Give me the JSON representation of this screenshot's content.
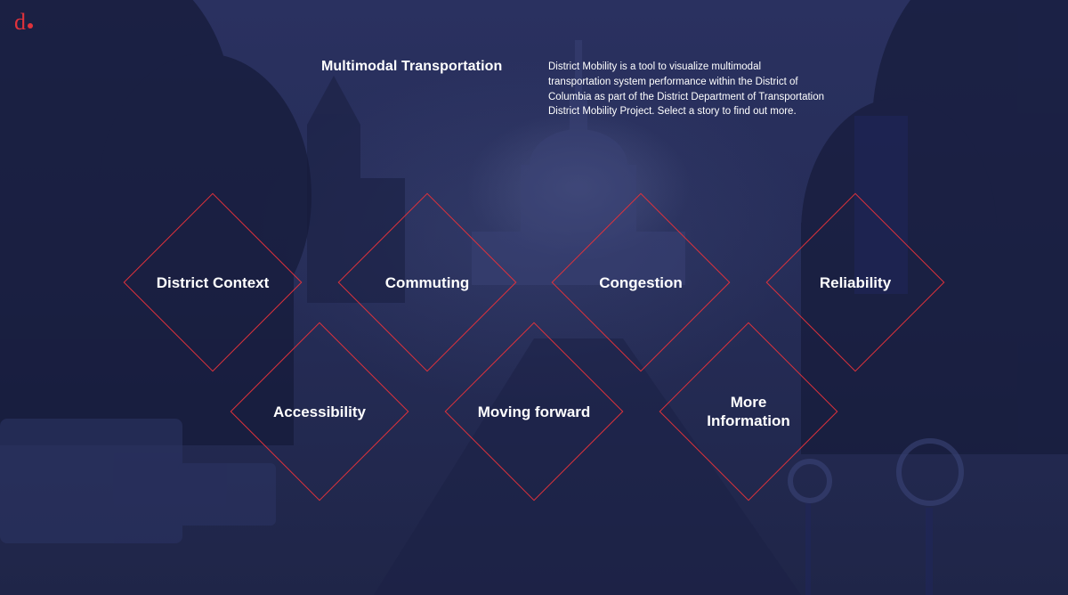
{
  "logo": {
    "letter": "d"
  },
  "intro": {
    "title": "Multimodal Transportation",
    "description": "District Mobility is a tool to visualize multimodal transportation system performance within the District of Columbia as part of the District Department of Transportation District Mobility Project. Select a story to find out more."
  },
  "stories": [
    {
      "label": "District Context"
    },
    {
      "label": "Commuting"
    },
    {
      "label": "Congestion"
    },
    {
      "label": "Reliability"
    },
    {
      "label": "Accessibility"
    },
    {
      "label": "Moving forward"
    },
    {
      "label": "More Information"
    }
  ],
  "colors": {
    "accent": "#e0323b",
    "background": "#232a52",
    "text": "#ffffff"
  }
}
